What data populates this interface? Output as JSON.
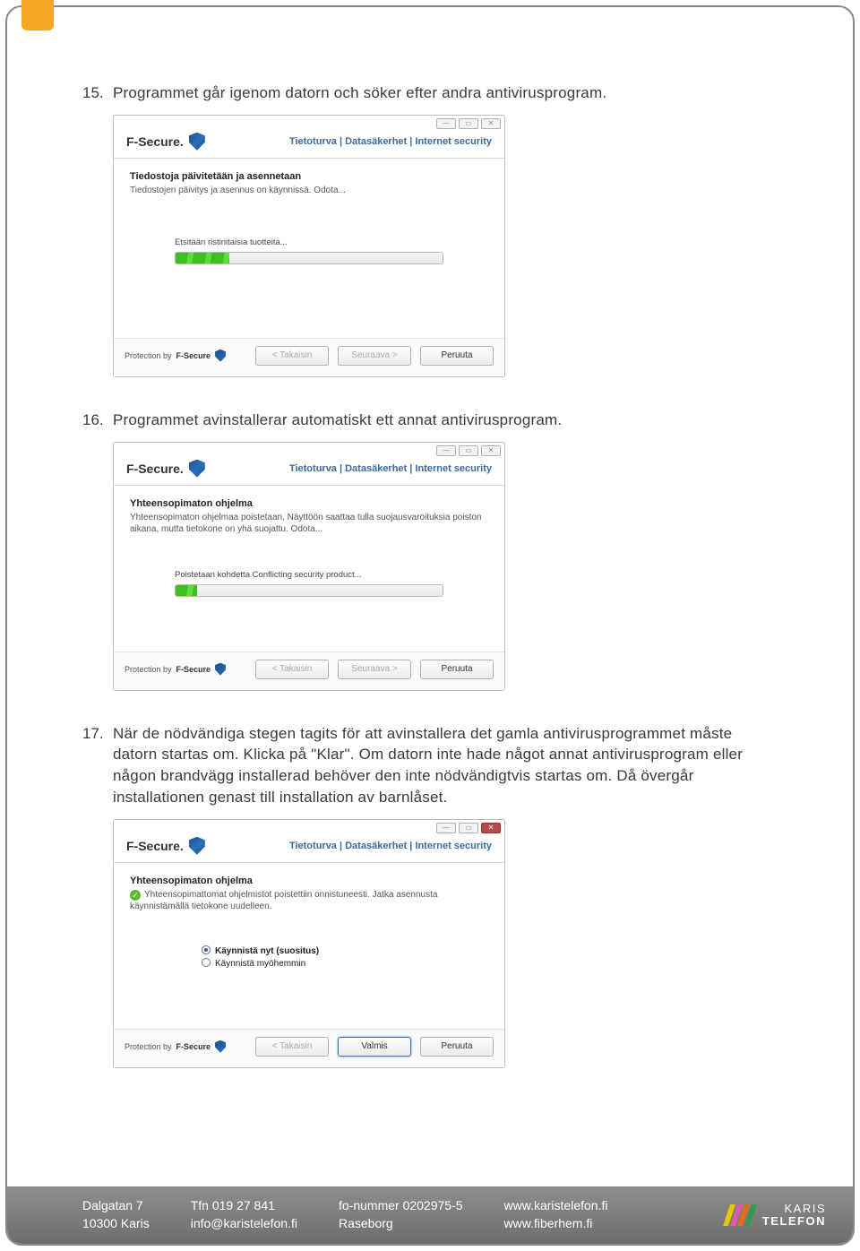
{
  "steps": {
    "15": {
      "num": "15.",
      "text": "Programmet går igenom datorn och söker efter andra antivirusprogram."
    },
    "16": {
      "num": "16.",
      "text": "Programmet avinstallerar automatiskt ett annat antivirusprogram."
    },
    "17": {
      "num": "17.",
      "text": "När de nödvändiga stegen tagits för att avinstallera det gamla antivirusprogrammet måste datorn startas om. Klicka på \"Klar\". Om datorn inte hade något annat antivirusprogram eller någon brandvägg installerad behöver den inte nödvändigtvis startas om. Då övergår installationen genast till installation av barnlåset."
    }
  },
  "common": {
    "brand": "F-Secure.",
    "tagline": "Tietoturva | Datasäkerhet | Internet security",
    "protection_prefix": "Protection by",
    "protection_name": "F-Secure",
    "btn_back": "< Takaisin",
    "btn_next": "Seuraava >",
    "btn_cancel": "Peruuta",
    "btn_done": "Valmis"
  },
  "dlg1": {
    "title": "Tiedostoja päivitetään ja asennetaan",
    "sub": "Tiedostojen päivitys ja asennus on käynnissä. Odota...",
    "progress_label": "Etsitään ristiriitaisia tuotteita...",
    "progress_pct": 20
  },
  "dlg2": {
    "title": "Yhteensopimaton ohjelma",
    "sub": "Yhteensopimaton ohjelmaa poistetaan. Näyttöön saattaa tulla suojausvaroituksia poiston aikana, mutta tietokone on yhä suojattu. Odota...",
    "progress_label": "Poistetaan kohdetta Conflicting security product...",
    "progress_pct": 8
  },
  "dlg3": {
    "title": "Yhteensopimaton ohjelma",
    "sub": "Yhteensopimattomat ohjelmistot poistettiin onnistuneesti. Jatka asennusta käynnistämällä tietokone uudelleen.",
    "radio1": "Käynnistä nyt (suositus)",
    "radio2": "Käynnistä myöhemmin"
  },
  "footer": {
    "c1a": "Dalgatan 7",
    "c1b": "10300 Karis",
    "c2a": "Tfn 019 27 841",
    "c2b": "info@karistelefon.fi",
    "c3a": "fo-nummer 0202975-5",
    "c3b": "Raseborg",
    "c4a": "www.karistelefon.fi",
    "c4b": "www.fiberhem.fi",
    "brand1": "KARIS",
    "brand2": "TELEFON"
  }
}
